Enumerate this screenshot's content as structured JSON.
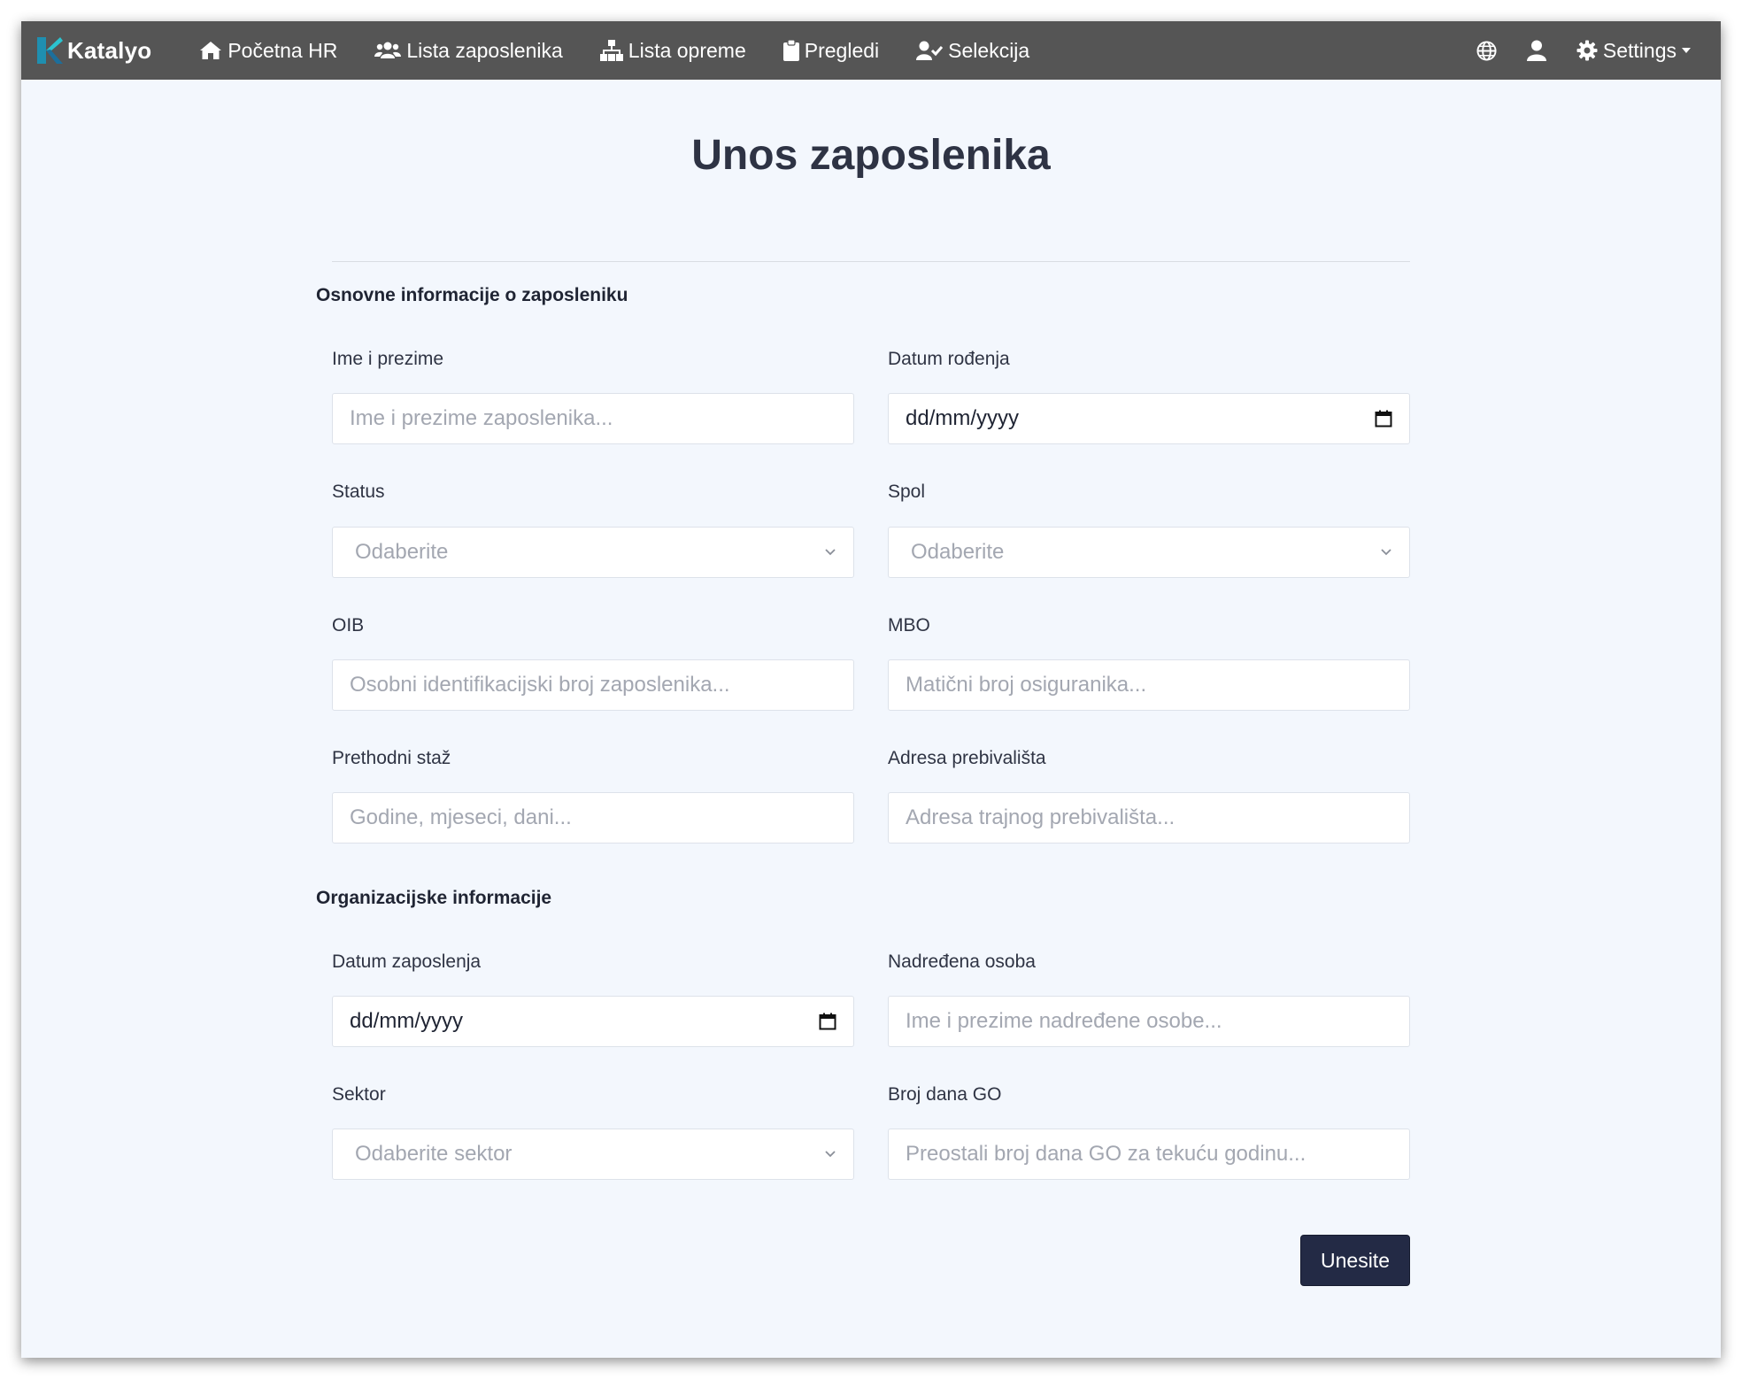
{
  "navbar": {
    "brand": "Katalyo",
    "items": [
      {
        "label": "Početna HR",
        "icon": "home-icon"
      },
      {
        "label": "Lista zaposlenika",
        "icon": "users-icon"
      },
      {
        "label": "Lista opreme",
        "icon": "sitemap-icon"
      },
      {
        "label": "Pregledi",
        "icon": "clipboard-icon"
      },
      {
        "label": "Selekcija",
        "icon": "user-check-icon"
      }
    ],
    "settings_label": "Settings"
  },
  "page": {
    "title": "Unos zaposlenika"
  },
  "sections": {
    "basic": {
      "title": "Osnovne informacije o zaposleniku",
      "full_name": {
        "label": "Ime i prezime",
        "placeholder": "Ime i prezime zaposlenika..."
      },
      "birth_date": {
        "label": "Datum rođenja",
        "value": "dd/mm/yyyy"
      },
      "status": {
        "label": "Status",
        "placeholder": "Odaberite"
      },
      "gender": {
        "label": "Spol",
        "placeholder": "Odaberite"
      },
      "oib": {
        "label": "OIB",
        "placeholder": "Osobni identifikacijski broj zaposlenika..."
      },
      "mbo": {
        "label": "MBO",
        "placeholder": "Matični broj osiguranika..."
      },
      "prev_service": {
        "label": "Prethodni staž",
        "placeholder": "Godine, mjeseci, dani..."
      },
      "address": {
        "label": "Adresa prebivališta",
        "placeholder": "Adresa trajnog prebivališta..."
      }
    },
    "org": {
      "title": "Organizacijske informacije",
      "hire_date": {
        "label": "Datum zaposlenja",
        "value": "dd/mm/yyyy"
      },
      "supervisor": {
        "label": "Nadređena osoba",
        "placeholder": "Ime i prezime nadređene osobe..."
      },
      "sector": {
        "label": "Sektor",
        "placeholder": "Odaberite sektor"
      },
      "leave_days": {
        "label": "Broj dana GO",
        "placeholder": "Preostali broj dana GO za tekuću godinu..."
      }
    }
  },
  "actions": {
    "submit_label": "Unesite"
  },
  "colors": {
    "navbar": "#555555",
    "background": "#f3f7fd",
    "submit": "#232a45",
    "brand_accent": "#2bb7c4"
  }
}
